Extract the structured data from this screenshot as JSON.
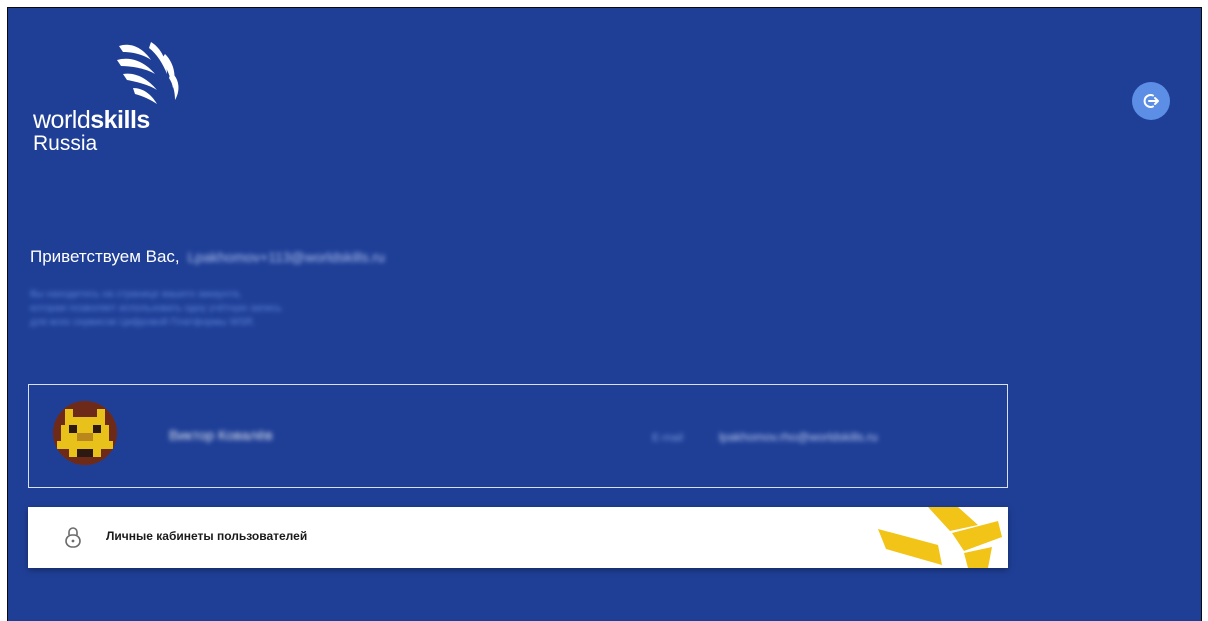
{
  "brand": {
    "world": "world",
    "skills": "skills",
    "country": "Russia"
  },
  "header": {
    "logout_icon": "logout-icon",
    "accent": "#5d8ee6"
  },
  "greeting": {
    "prefix": "Приветствуем Вас,",
    "email": "Lpakhomov+113@worldskills.ru"
  },
  "intro": {
    "line1": "Вы находитесь на странице вашего аккаунта,",
    "line2": "которая позволяет использовать одну учётную запись",
    "line3": "для всех сервисов Цифровой Платформы WSR."
  },
  "profile": {
    "name": "Виктор Ковалёв",
    "email_label": "E-mail",
    "email_value": "lpakhomov.rho@worldskills.ru"
  },
  "cabinets": {
    "label": "Личные кабинеты пользователей",
    "icon": "lock-icon"
  },
  "colors": {
    "background": "#1f3f97",
    "accent_yellow": "#f2c417"
  }
}
